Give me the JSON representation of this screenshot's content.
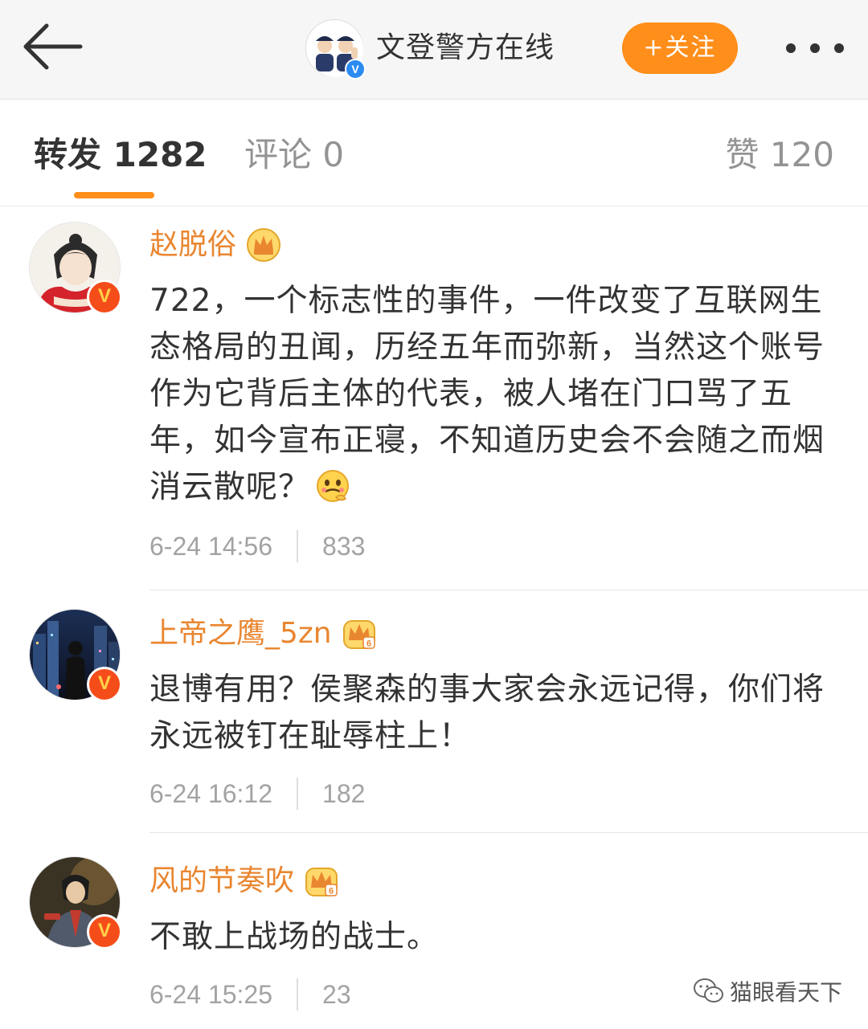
{
  "header": {
    "back_icon": "arrow-left-icon",
    "account_name": "文登警方在线",
    "verified_badge": "V",
    "follow_label": "+关注",
    "more_icon": "more-dots-icon"
  },
  "tabs": {
    "repost": "转发 1282",
    "comment": "评论 0",
    "like": "赞 120",
    "active_color": "#ff8e1a"
  },
  "comments": [
    {
      "username": "赵脱俗",
      "verified_badge": "V",
      "badge_icon": "crown-icon",
      "text": "722，一个标志性的事件，一件改变了互联网生态格局的丑闻，历经五年而弥新，当然这个账号作为它背后主体的代表，被人堵在门口骂了五年，如今宣布正寝，不知道历史会不会随之而烟消云散呢？",
      "emoji": "thinking-face-emoji",
      "time": "6-24 14:56",
      "likes": "833"
    },
    {
      "username": "上帝之鹰_5zn",
      "verified_badge": "V",
      "badge_icon": "crown-level-6-icon",
      "text": "退博有用？侯聚森的事大家会永远记得，你们将永远被钉在耻辱柱上！",
      "time": "6-24 16:12",
      "likes": "182"
    },
    {
      "username": "风的节奏吹",
      "verified_badge": "V",
      "badge_icon": "crown-level-6-icon",
      "text": "不敢上战场的战士。",
      "time": "6-24 15:25",
      "likes": "23"
    }
  ],
  "watermark": {
    "icon": "wechat-icon",
    "text": "猫眼看天下"
  },
  "colors": {
    "username": "#e98630",
    "follow_button": "#ff8e1a",
    "verified_orange": "#f54d1a",
    "verified_blue": "#2c8bf0"
  }
}
